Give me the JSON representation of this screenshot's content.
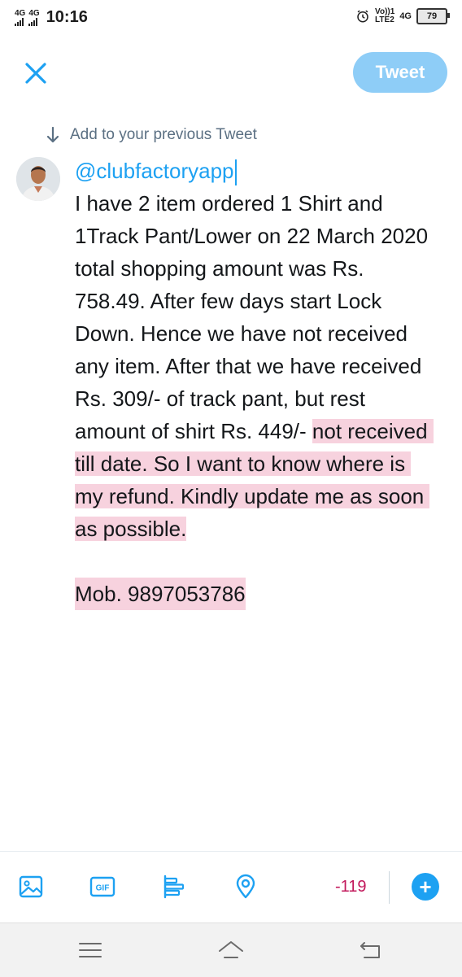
{
  "status_bar": {
    "network_left_1": "4G",
    "network_left_2": "4G",
    "time": "10:16",
    "volte_top": "Vo))1",
    "volte_bottom": "LTE2",
    "network_right": "4G",
    "battery": "79"
  },
  "header": {
    "tweet_button_label": "Tweet"
  },
  "thread": {
    "hint": "Add to your previous Tweet"
  },
  "compose": {
    "mention": "@clubfactoryapp",
    "text_part1": "I have 2 item ordered 1 Shirt and 1Track Pant/Lower on 22 March 2020 total shopping amount was Rs. 758.49. After few days start Lock Down. Hence we have not received any item. After that we have received Rs. 309/- of track pant, but rest amount of shirt Rs. 449/- ",
    "text_part2_highlighted": "not received till date. So I want to know where is my refund. Kindly update me as soon as possible.",
    "mobile": "Mob. 9897053786"
  },
  "toolbar": {
    "gif_label": "GIF",
    "char_counter": "-119",
    "accent_color": "#1da1f2",
    "counter_color": "#c2185b"
  }
}
